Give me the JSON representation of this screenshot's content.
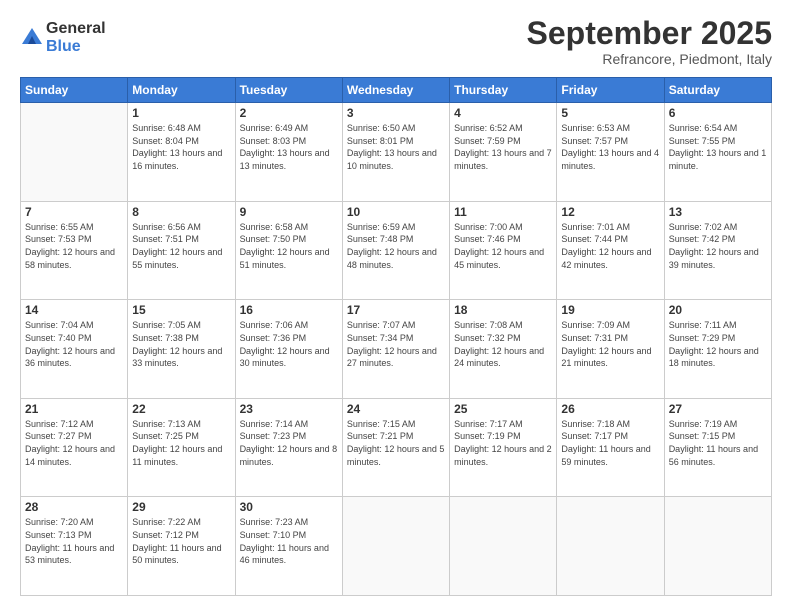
{
  "header": {
    "logo_line1": "General",
    "logo_line2": "Blue",
    "month": "September 2025",
    "location": "Refrancore, Piedmont, Italy"
  },
  "days_of_week": [
    "Sunday",
    "Monday",
    "Tuesday",
    "Wednesday",
    "Thursday",
    "Friday",
    "Saturday"
  ],
  "weeks": [
    [
      null,
      {
        "num": "1",
        "sunrise": "6:48 AM",
        "sunset": "8:04 PM",
        "daylight": "13 hours and 16 minutes."
      },
      {
        "num": "2",
        "sunrise": "6:49 AM",
        "sunset": "8:03 PM",
        "daylight": "13 hours and 13 minutes."
      },
      {
        "num": "3",
        "sunrise": "6:50 AM",
        "sunset": "8:01 PM",
        "daylight": "13 hours and 10 minutes."
      },
      {
        "num": "4",
        "sunrise": "6:52 AM",
        "sunset": "7:59 PM",
        "daylight": "13 hours and 7 minutes."
      },
      {
        "num": "5",
        "sunrise": "6:53 AM",
        "sunset": "7:57 PM",
        "daylight": "13 hours and 4 minutes."
      },
      {
        "num": "6",
        "sunrise": "6:54 AM",
        "sunset": "7:55 PM",
        "daylight": "13 hours and 1 minute."
      }
    ],
    [
      {
        "num": "7",
        "sunrise": "6:55 AM",
        "sunset": "7:53 PM",
        "daylight": "12 hours and 58 minutes."
      },
      {
        "num": "8",
        "sunrise": "6:56 AM",
        "sunset": "7:51 PM",
        "daylight": "12 hours and 55 minutes."
      },
      {
        "num": "9",
        "sunrise": "6:58 AM",
        "sunset": "7:50 PM",
        "daylight": "12 hours and 51 minutes."
      },
      {
        "num": "10",
        "sunrise": "6:59 AM",
        "sunset": "7:48 PM",
        "daylight": "12 hours and 48 minutes."
      },
      {
        "num": "11",
        "sunrise": "7:00 AM",
        "sunset": "7:46 PM",
        "daylight": "12 hours and 45 minutes."
      },
      {
        "num": "12",
        "sunrise": "7:01 AM",
        "sunset": "7:44 PM",
        "daylight": "12 hours and 42 minutes."
      },
      {
        "num": "13",
        "sunrise": "7:02 AM",
        "sunset": "7:42 PM",
        "daylight": "12 hours and 39 minutes."
      }
    ],
    [
      {
        "num": "14",
        "sunrise": "7:04 AM",
        "sunset": "7:40 PM",
        "daylight": "12 hours and 36 minutes."
      },
      {
        "num": "15",
        "sunrise": "7:05 AM",
        "sunset": "7:38 PM",
        "daylight": "12 hours and 33 minutes."
      },
      {
        "num": "16",
        "sunrise": "7:06 AM",
        "sunset": "7:36 PM",
        "daylight": "12 hours and 30 minutes."
      },
      {
        "num": "17",
        "sunrise": "7:07 AM",
        "sunset": "7:34 PM",
        "daylight": "12 hours and 27 minutes."
      },
      {
        "num": "18",
        "sunrise": "7:08 AM",
        "sunset": "7:32 PM",
        "daylight": "12 hours and 24 minutes."
      },
      {
        "num": "19",
        "sunrise": "7:09 AM",
        "sunset": "7:31 PM",
        "daylight": "12 hours and 21 minutes."
      },
      {
        "num": "20",
        "sunrise": "7:11 AM",
        "sunset": "7:29 PM",
        "daylight": "12 hours and 18 minutes."
      }
    ],
    [
      {
        "num": "21",
        "sunrise": "7:12 AM",
        "sunset": "7:27 PM",
        "daylight": "12 hours and 14 minutes."
      },
      {
        "num": "22",
        "sunrise": "7:13 AM",
        "sunset": "7:25 PM",
        "daylight": "12 hours and 11 minutes."
      },
      {
        "num": "23",
        "sunrise": "7:14 AM",
        "sunset": "7:23 PM",
        "daylight": "12 hours and 8 minutes."
      },
      {
        "num": "24",
        "sunrise": "7:15 AM",
        "sunset": "7:21 PM",
        "daylight": "12 hours and 5 minutes."
      },
      {
        "num": "25",
        "sunrise": "7:17 AM",
        "sunset": "7:19 PM",
        "daylight": "12 hours and 2 minutes."
      },
      {
        "num": "26",
        "sunrise": "7:18 AM",
        "sunset": "7:17 PM",
        "daylight": "11 hours and 59 minutes."
      },
      {
        "num": "27",
        "sunrise": "7:19 AM",
        "sunset": "7:15 PM",
        "daylight": "11 hours and 56 minutes."
      }
    ],
    [
      {
        "num": "28",
        "sunrise": "7:20 AM",
        "sunset": "7:13 PM",
        "daylight": "11 hours and 53 minutes."
      },
      {
        "num": "29",
        "sunrise": "7:22 AM",
        "sunset": "7:12 PM",
        "daylight": "11 hours and 50 minutes."
      },
      {
        "num": "30",
        "sunrise": "7:23 AM",
        "sunset": "7:10 PM",
        "daylight": "11 hours and 46 minutes."
      },
      null,
      null,
      null,
      null
    ]
  ]
}
